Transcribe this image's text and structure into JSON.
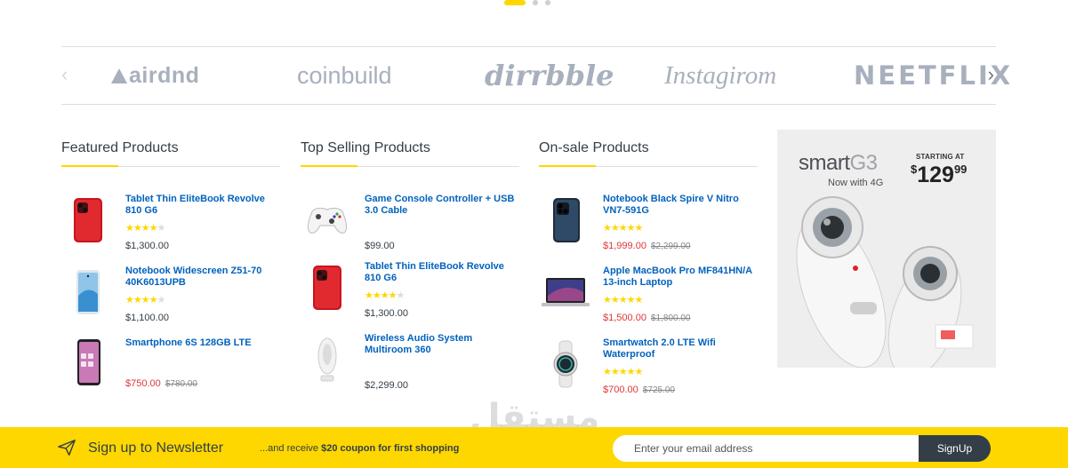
{
  "carousel": {
    "dots": 3,
    "active": 0
  },
  "brands": {
    "items": [
      "airdnd",
      "coinbuild",
      "dirrbble",
      "Instagirom",
      "NEETFLIX"
    ],
    "prev_icon": "chevron-left-icon",
    "next_icon": "chevron-right-icon"
  },
  "featured": {
    "title": "Featured Products",
    "items": [
      {
        "title": "Tablet Thin EliteBook Revolve 810 G6",
        "rating": 4.5,
        "price": "$1,300.00",
        "old_price": ""
      },
      {
        "title": "Notebook Widescreen Z51-70 40K6013UPB",
        "rating": 4.5,
        "price": "$1,100.00",
        "old_price": ""
      },
      {
        "title": "Smartphone 6S 128GB LTE",
        "rating": 0,
        "price": "$750.00",
        "old_price": "$780.00"
      }
    ]
  },
  "top_selling": {
    "title": "Top Selling Products",
    "items": [
      {
        "title": "Game Console Controller + USB 3.0 Cable",
        "rating": 0,
        "price": "$99.00",
        "old_price": ""
      },
      {
        "title": "Tablet Thin EliteBook Revolve 810 G6",
        "rating": 4.5,
        "price": "$1,300.00",
        "old_price": ""
      },
      {
        "title": "Wireless Audio System Multiroom 360",
        "rating": 0,
        "price": "$2,299.00",
        "old_price": ""
      }
    ]
  },
  "on_sale": {
    "title": "On-sale Products",
    "items": [
      {
        "title": "Notebook Black Spire V Nitro VN7-591G",
        "rating": 5,
        "price": "$1,999.00",
        "old_price": "$2,299.00"
      },
      {
        "title": "Apple MacBook Pro MF841HN/A 13-inch Laptop",
        "rating": 5,
        "price": "$1,500.00",
        "old_price": "$1,800.00"
      },
      {
        "title": "Smartwatch 2.0 LTE Wifi Waterproof",
        "rating": 5,
        "price": "$700.00",
        "old_price": "$725.00"
      }
    ]
  },
  "ad": {
    "brand_main": "smart",
    "brand_model": "G3",
    "subtitle": "Now with 4G",
    "starting_label": "STARTING AT",
    "currency": "$",
    "price_main": "129",
    "price_cents": "99"
  },
  "newsletter": {
    "title": "Sign up to Newsletter",
    "sub_prefix": "...and receive ",
    "sub_bold": "$20 coupon for first shopping",
    "email_placeholder": "Enter your email address",
    "button_label": "SignUp",
    "icon": "paper-plane-icon"
  },
  "watermark": {
    "text": "مستقل",
    "url": "mostaql.com"
  },
  "colors": {
    "accent": "#fed700",
    "link": "#0062bd",
    "sale": "#df3737",
    "dark": "#333e48"
  }
}
